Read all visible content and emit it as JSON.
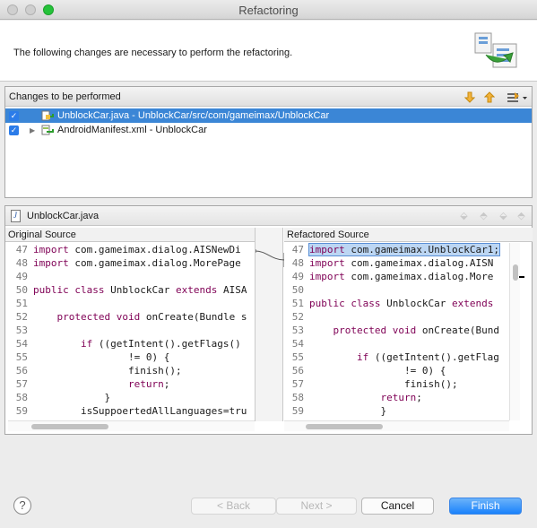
{
  "window": {
    "title": "Refactoring"
  },
  "header": {
    "message": "The following changes are necessary to perform the refactoring."
  },
  "changes": {
    "title": "Changes to be performed",
    "items": [
      {
        "label": "UnblockCar.java - UnblockCar/src/com/gameimax/UnblockCar",
        "checked": true,
        "selected": true
      },
      {
        "label": "AndroidManifest.xml - UnblockCar",
        "checked": true,
        "selected": false
      }
    ]
  },
  "compare": {
    "file": "UnblockCar.java",
    "original_label": "Original Source",
    "refactored_label": "Refactored Source",
    "original_lines": [
      {
        "n": "47",
        "t": "import com.gameimax.dialog.AISNewDi"
      },
      {
        "n": "48",
        "t": "import com.gameimax.dialog.MorePage"
      },
      {
        "n": "49",
        "t": ""
      },
      {
        "n": "50",
        "t": "public class UnblockCar extends AISA"
      },
      {
        "n": "51",
        "t": ""
      },
      {
        "n": "52",
        "t": "    protected void onCreate(Bundle s"
      },
      {
        "n": "53",
        "t": ""
      },
      {
        "n": "54",
        "t": "        if ((getIntent().getFlags()"
      },
      {
        "n": "55",
        "t": "                != 0) {"
      },
      {
        "n": "56",
        "t": "                finish();"
      },
      {
        "n": "57",
        "t": "                return;"
      },
      {
        "n": "58",
        "t": "            }"
      },
      {
        "n": "59",
        "t": "        isSuppoertedAllLanguages=tru"
      }
    ],
    "refactored_lines": [
      {
        "n": "47",
        "t": "import com.gameimax.UnblockCar1;"
      },
      {
        "n": "48",
        "t": "import com.gameimax.dialog.AISN"
      },
      {
        "n": "49",
        "t": "import com.gameimax.dialog.More"
      },
      {
        "n": "50",
        "t": ""
      },
      {
        "n": "51",
        "t": "public class UnblockCar extends"
      },
      {
        "n": "52",
        "t": ""
      },
      {
        "n": "53",
        "t": "    protected void onCreate(Bund"
      },
      {
        "n": "54",
        "t": ""
      },
      {
        "n": "55",
        "t": "        if ((getIntent().getFlag"
      },
      {
        "n": "56",
        "t": "                != 0) {"
      },
      {
        "n": "57",
        "t": "                finish();"
      },
      {
        "n": "58",
        "t": "            return;"
      },
      {
        "n": "59",
        "t": "            }"
      }
    ]
  },
  "buttons": {
    "back": "< Back",
    "next": "Next >",
    "cancel": "Cancel",
    "finish": "Finish",
    "help": "?"
  },
  "colors": {
    "accent": "#3b86d6",
    "keyword": "#7f0055",
    "primary_button": "#1a82fb"
  }
}
